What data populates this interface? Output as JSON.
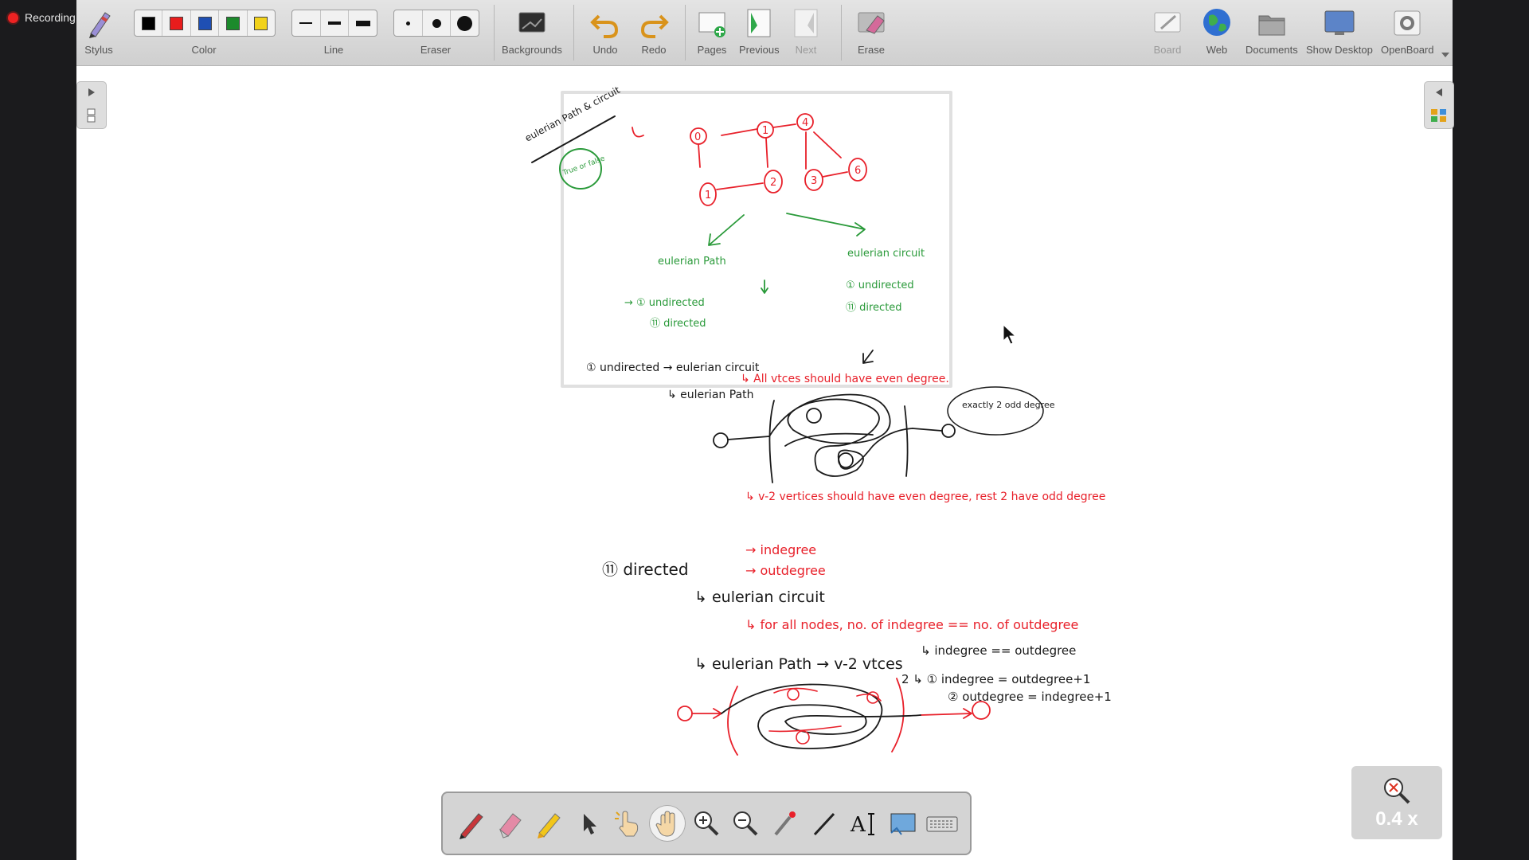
{
  "recording": {
    "label": "Recording"
  },
  "toolbar": {
    "stylus": "Stylus",
    "color": "Color",
    "line": "Line",
    "eraser": "Eraser",
    "backgrounds": "Backgrounds",
    "undo": "Undo",
    "redo": "Redo",
    "pages": "Pages",
    "previous": "Previous",
    "next": "Next",
    "erase": "Erase",
    "board": "Board",
    "web": "Web",
    "documents": "Documents",
    "show_desktop": "Show Desktop",
    "openboard": "OpenBoard"
  },
  "colors": {
    "palette": [
      "#000000",
      "#e81c1c",
      "#1f4fb3",
      "#1c8a2c",
      "#f2d21a"
    ],
    "ink_red": "#e8202a",
    "ink_green": "#2a9a3a",
    "ink_black": "#1a1a1a"
  },
  "zoom": {
    "value": "0.4 x"
  },
  "board_text": {
    "t1": "eulerian Path & circuit",
    "t2": "True or false",
    "t3": "eulerian Path",
    "t4": "eulerian circuit",
    "t5": "→ ① undirected",
    "t6": "⑪ directed",
    "t7": "① undirected",
    "t8": "⑪ directed",
    "t9": "① undirected → eulerian circuit",
    "t10": "↳ All vtces should have even degree.",
    "t11": "↳ eulerian Path",
    "t12": "exactly 2 odd degree",
    "t13": "↳ v-2 vertices should have even degree, rest 2 have odd degree",
    "t14": "⑪ directed",
    "t15": "→ indegree",
    "t16": "→ outdegree",
    "t17": "↳ eulerian circuit",
    "t18": "↳ for all nodes, no. of indegree == no. of outdegree",
    "t19": "↳ eulerian Path → v-2 vtces",
    "t20": "↳ indegree == outdegree",
    "t21": "2 ↳ ① indegree = outdegree+1",
    "t22": "② outdegree = indegree+1",
    "n0": "0",
    "n1": "1",
    "n2": "2",
    "n3": "3",
    "n4": "4",
    "n5": "5",
    "n6": "6"
  }
}
